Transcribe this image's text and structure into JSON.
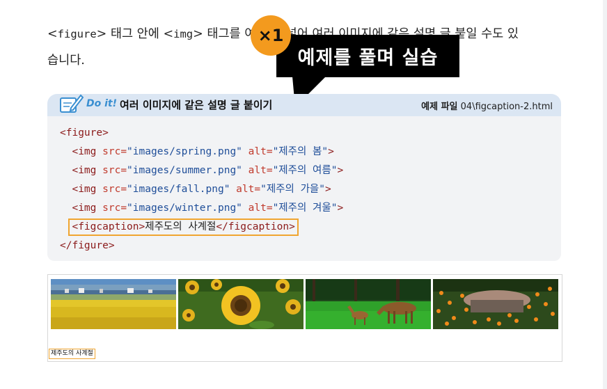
{
  "intro": {
    "seg1": "figure",
    "seg2": " 태그 안에 ",
    "seg3": "img",
    "seg4": " 태그를 여러 개 넣어 여러 이미지에 같은 설명 글 붙일 수도 있",
    "line2": "습니다."
  },
  "callout": {
    "badge": "×1",
    "text": "예제를 풀며 실습"
  },
  "doit": {
    "label": "Do it!",
    "title": "여러 이미지에 같은 설명 글 붙이기",
    "file_prefix": "예제 파일",
    "file_path": "04\\figcaption-2.html"
  },
  "code": {
    "figure_open": "<figure>",
    "images": [
      {
        "src": "\"images/spring.png\"",
        "alt": "\"제주의 봄\""
      },
      {
        "src": "\"images/summer.png\"",
        "alt": "\"제주의 여름\""
      },
      {
        "src": "\"images/fall.png\"",
        "alt": "\"제주의 가을\""
      },
      {
        "src": "\"images/winter.png\"",
        "alt": "\"제주의 겨울\""
      }
    ],
    "img_tag": "<img ",
    "src_attr": "src=",
    "alt_attr": " alt=",
    "close": ">",
    "figcaption_open": "<figcaption>",
    "figcaption_text": "제주도의 사계절",
    "figcaption_close": "</figcaption>",
    "figure_close": "</figure>"
  },
  "preview": {
    "caption": "제주도의 사계절",
    "photos": [
      "spring-photo",
      "summer-photo",
      "fall-photo",
      "winter-photo"
    ]
  },
  "colors": {
    "accent_orange": "#f39a1e",
    "doit_bar": "#dbe6f3",
    "doit_blue": "#3a8fd1",
    "code_bg": "#f2f3f5",
    "tag": "#8b1a1a",
    "attr": "#c0392b",
    "value": "#1f4e99"
  }
}
